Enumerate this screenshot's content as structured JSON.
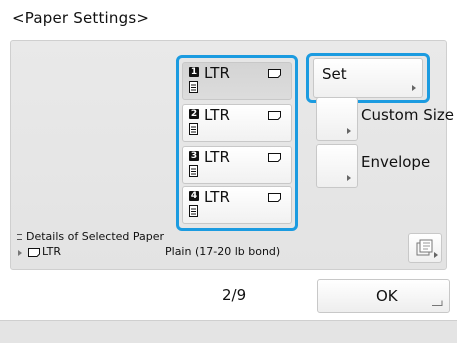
{
  "header": {
    "title": "<Paper Settings>"
  },
  "drawers": [
    {
      "number": "1",
      "label": "LTR",
      "selected": true
    },
    {
      "number": "2",
      "label": "LTR",
      "selected": false
    },
    {
      "number": "3",
      "label": "LTR",
      "selected": false
    },
    {
      "number": "4",
      "label": "LTR",
      "selected": false
    }
  ],
  "actions": {
    "set_label": "Set",
    "custom_size_label": "Custom Size",
    "envelope_label": "Envelope"
  },
  "details": {
    "title": "Details of Selected Paper",
    "paper_size": "LTR",
    "paper_type": "Plain (17-20 lb bond)"
  },
  "footer": {
    "page_indicator": "2/9",
    "ok_label": "OK"
  },
  "colors": {
    "selection_accent": "#1b9be0"
  },
  "icons": [
    "drawer-number-icon",
    "paper-stack-icon",
    "paper-landscape-icon",
    "settings-icon",
    "arrow-icon"
  ]
}
